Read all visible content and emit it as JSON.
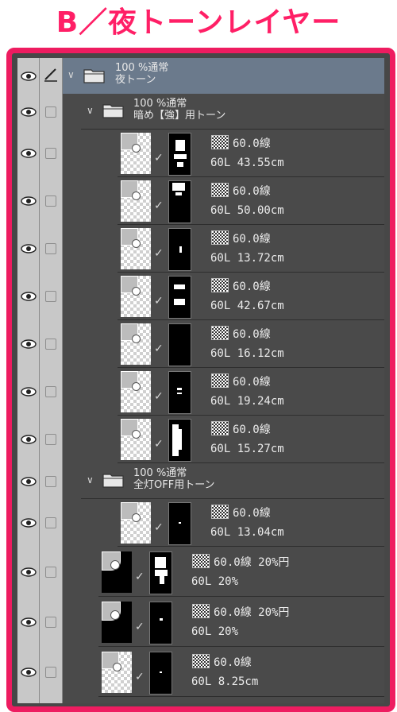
{
  "title": "B／夜トーンレイヤー",
  "colors": {
    "accent": "#ee1c60",
    "title": "#ff1f66",
    "panel": "#4a4a4a",
    "selected": "#6b7a8c"
  },
  "root_folder": {
    "opacity_mode": "100 %通常",
    "name": "夜トーン",
    "selected": true
  },
  "folders": [
    {
      "opacity_mode": "100 %通常",
      "name": "暗め【強】用トーン",
      "layers": [
        {
          "line": "60.0線",
          "size": "60L 43.55cm"
        },
        {
          "line": "60.0線",
          "size": "60L 50.00cm"
        },
        {
          "line": "60.0線",
          "size": "60L 13.72cm"
        },
        {
          "line": "60.0線",
          "size": "60L 42.67cm"
        },
        {
          "line": "60.0線",
          "size": "60L 16.12cm"
        },
        {
          "line": "60.0線",
          "size": "60L 19.24cm"
        },
        {
          "line": "60.0線",
          "size": "60L 15.27cm"
        }
      ]
    },
    {
      "opacity_mode": "100 %通常",
      "name": "全灯OFF用トーン",
      "layers": [
        {
          "line": "60.0線",
          "size": "60L 13.04cm"
        }
      ]
    }
  ],
  "root_layers": [
    {
      "line": "60.0線 20%円",
      "size": "60L 20%"
    },
    {
      "line": "60.0線 20%円",
      "size": "60L 20%"
    },
    {
      "line": "60.0線",
      "size": "60L 8.25cm"
    }
  ],
  "icons": {
    "visibility": "eye-icon",
    "lock": "checkbox",
    "edit": "pencil-icon",
    "folder": "folder-icon",
    "expand": "chevron-down-icon"
  }
}
